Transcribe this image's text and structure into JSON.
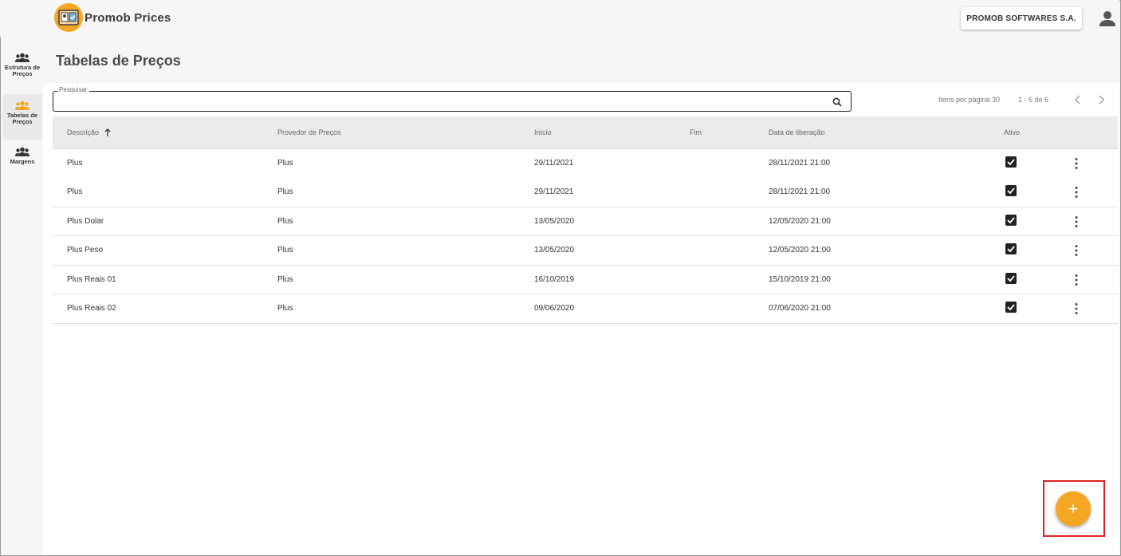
{
  "app": {
    "title": "Promob Prices",
    "company": "PROMOB SOFTWARES S.A.",
    "accent_color": "#f5a623"
  },
  "sidebar": {
    "items": [
      {
        "label": "Estrutura de Preços",
        "icon": "group-icon",
        "active": false
      },
      {
        "label": "Tabelas de Preços",
        "icon": "group-icon",
        "active": true
      },
      {
        "label": "Margens",
        "icon": "group-icon",
        "active": false
      }
    ]
  },
  "page": {
    "title": "Tabelas de Preços"
  },
  "search": {
    "label": "Pesquisar",
    "value": ""
  },
  "paginator": {
    "items_per_page": "Itens por página 30",
    "range": "1 - 6 de 6"
  },
  "table": {
    "headers": {
      "descricao": "Descrição",
      "provedor": "Provedor de Preços",
      "inicio": "Início",
      "fim": "Fim",
      "liberacao": "Data de liberação",
      "ativo": "Ativo"
    },
    "rows": [
      {
        "descricao": "Plus",
        "provedor": "Plus",
        "inicio": "29/11/2021",
        "fim": "",
        "liberacao": "28/11/2021 21:00",
        "ativo": true
      },
      {
        "descricao": "Plus",
        "provedor": "Plus",
        "inicio": "29/11/2021",
        "fim": "",
        "liberacao": "28/11/2021 21:00",
        "ativo": true
      },
      {
        "descricao": "Plus Dolar",
        "provedor": "Plus",
        "inicio": "13/05/2020",
        "fim": "",
        "liberacao": "12/05/2020 21:00",
        "ativo": true
      },
      {
        "descricao": "Plus Peso",
        "provedor": "Plus",
        "inicio": "13/05/2020",
        "fim": "",
        "liberacao": "12/05/2020 21:00",
        "ativo": true
      },
      {
        "descricao": "Plus Reais 01",
        "provedor": "Plus",
        "inicio": "16/10/2019",
        "fim": "",
        "liberacao": "15/10/2019 21:00",
        "ativo": true
      },
      {
        "descricao": "Plus Reais 02",
        "provedor": "Plus",
        "inicio": "09/06/2020",
        "fim": "",
        "liberacao": "07/06/2020 21:00",
        "ativo": true
      }
    ]
  },
  "fab": {
    "label": "+"
  }
}
